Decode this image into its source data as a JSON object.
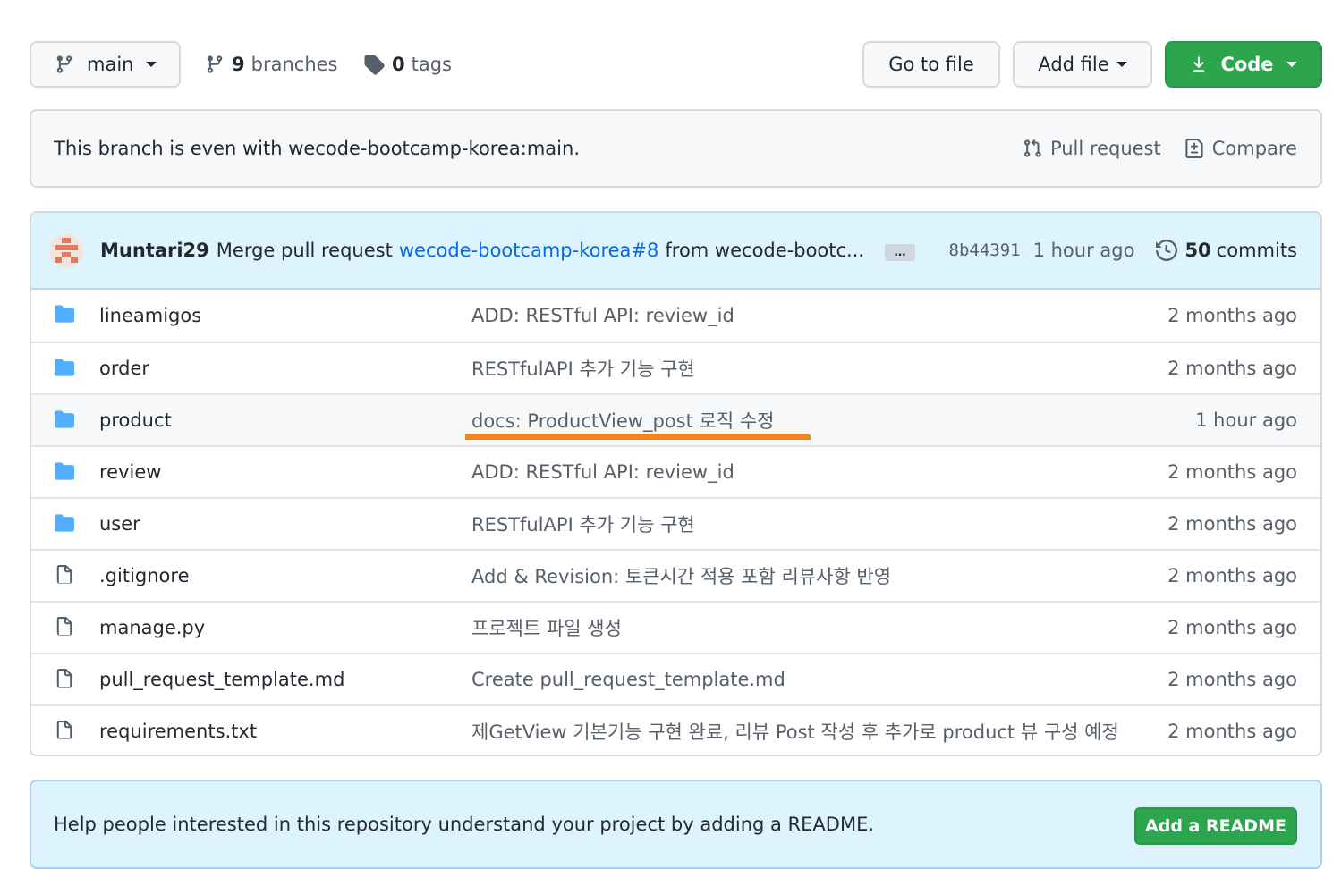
{
  "toolbar": {
    "branch_label": "main",
    "branches_count": "9",
    "branches_label": "branches",
    "tags_count": "0",
    "tags_label": "tags",
    "goto_label": "Go to file",
    "addfile_label": "Add file",
    "code_label": "Code"
  },
  "branch_status": {
    "text": "This branch is even with wecode-bootcamp-korea:main.",
    "pull_request_label": "Pull request",
    "compare_label": "Compare"
  },
  "latest_commit": {
    "author": "Muntari29",
    "message_prefix": "Merge pull request",
    "pr_link": "wecode-bootcamp-korea#8",
    "message_suffix": "from wecode-bootc...",
    "ellipsis": "…",
    "sha": "8b44391",
    "age": "1 hour ago",
    "commits_count": "50",
    "commits_label": "commits"
  },
  "files": [
    {
      "type": "folder",
      "name": "lineamigos",
      "message": "ADD: RESTful API: review_id",
      "age": "2 months ago"
    },
    {
      "type": "folder",
      "name": "order",
      "message": "RESTfulAPI 추가 기능 구현",
      "age": "2 months ago"
    },
    {
      "type": "folder",
      "name": "product",
      "message": "docs: ProductView_post 로직 수정",
      "age": "1 hour ago"
    },
    {
      "type": "folder",
      "name": "review",
      "message": "ADD: RESTful API: review_id",
      "age": "2 months ago"
    },
    {
      "type": "folder",
      "name": "user",
      "message": "RESTfulAPI 추가 기능 구현",
      "age": "2 months ago"
    },
    {
      "type": "file",
      "name": ".gitignore",
      "message": "Add & Revision: 토큰시간 적용 포함 리뷰사항 반영",
      "age": "2 months ago"
    },
    {
      "type": "file",
      "name": "manage.py",
      "message": "프로젝트 파일 생성",
      "age": "2 months ago"
    },
    {
      "type": "file",
      "name": "pull_request_template.md",
      "message": "Create pull_request_template.md",
      "age": "2 months ago"
    },
    {
      "type": "file",
      "name": "requirements.txt",
      "message": "제GetView 기본기능 구현 완료, 리뷰 Post 작성 후 추가로 product 뷰 구성 예정",
      "age": "2 months ago"
    }
  ],
  "readme_prompt": {
    "text": "Help people interested in this repository understand your project by adding a README.",
    "button_label": "Add a README"
  },
  "colors": {
    "accent_green": "#2da44e",
    "link_blue": "#0969da",
    "folder_blue": "#54aeff",
    "highlight_orange": "#f5861f"
  }
}
